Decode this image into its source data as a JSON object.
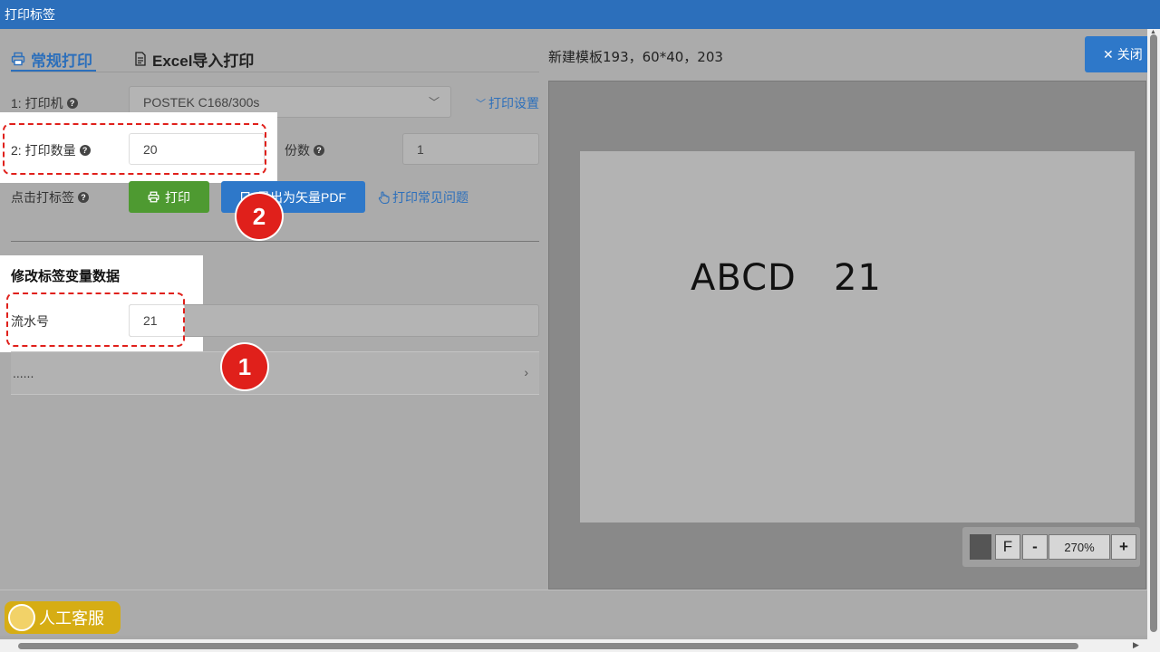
{
  "window": {
    "title": "打印标签"
  },
  "tabs": [
    {
      "label": "常规打印",
      "active": true
    },
    {
      "label": "Excel导入打印",
      "active": false
    }
  ],
  "form": {
    "printer_label": "1: 打印机",
    "printer_value": "POSTEK C168/300s",
    "print_settings_link": "打印设置",
    "quantity_label": "2: 打印数量",
    "quantity_value": "20",
    "copies_label": "份数",
    "copies_value": "1",
    "click_print_label": "点击打标签",
    "print_button": "打印",
    "pdf_button": "导出为矢量PDF",
    "faq_link": "打印常见问题"
  },
  "variables": {
    "section_title": "修改标签变量数据",
    "serial_label": "流水号",
    "serial_value": "21",
    "more_row": "......"
  },
  "annotations": {
    "badge_1": "1",
    "badge_2": "2",
    "highlight_color": "#e0201b"
  },
  "preview": {
    "template_title": "新建模板193，60*40，203",
    "close_button": "关闭",
    "label_text": "ABCD   21",
    "zoom_fit": "F",
    "zoom_minus": "-",
    "zoom_value": "270%",
    "zoom_plus": "+"
  },
  "customer_service": "人工客服",
  "colors": {
    "titlebar": "#2c6fbb",
    "print_button": "#4e9a31",
    "pdf_button": "#2e78c9",
    "service": "#d6ad14"
  }
}
